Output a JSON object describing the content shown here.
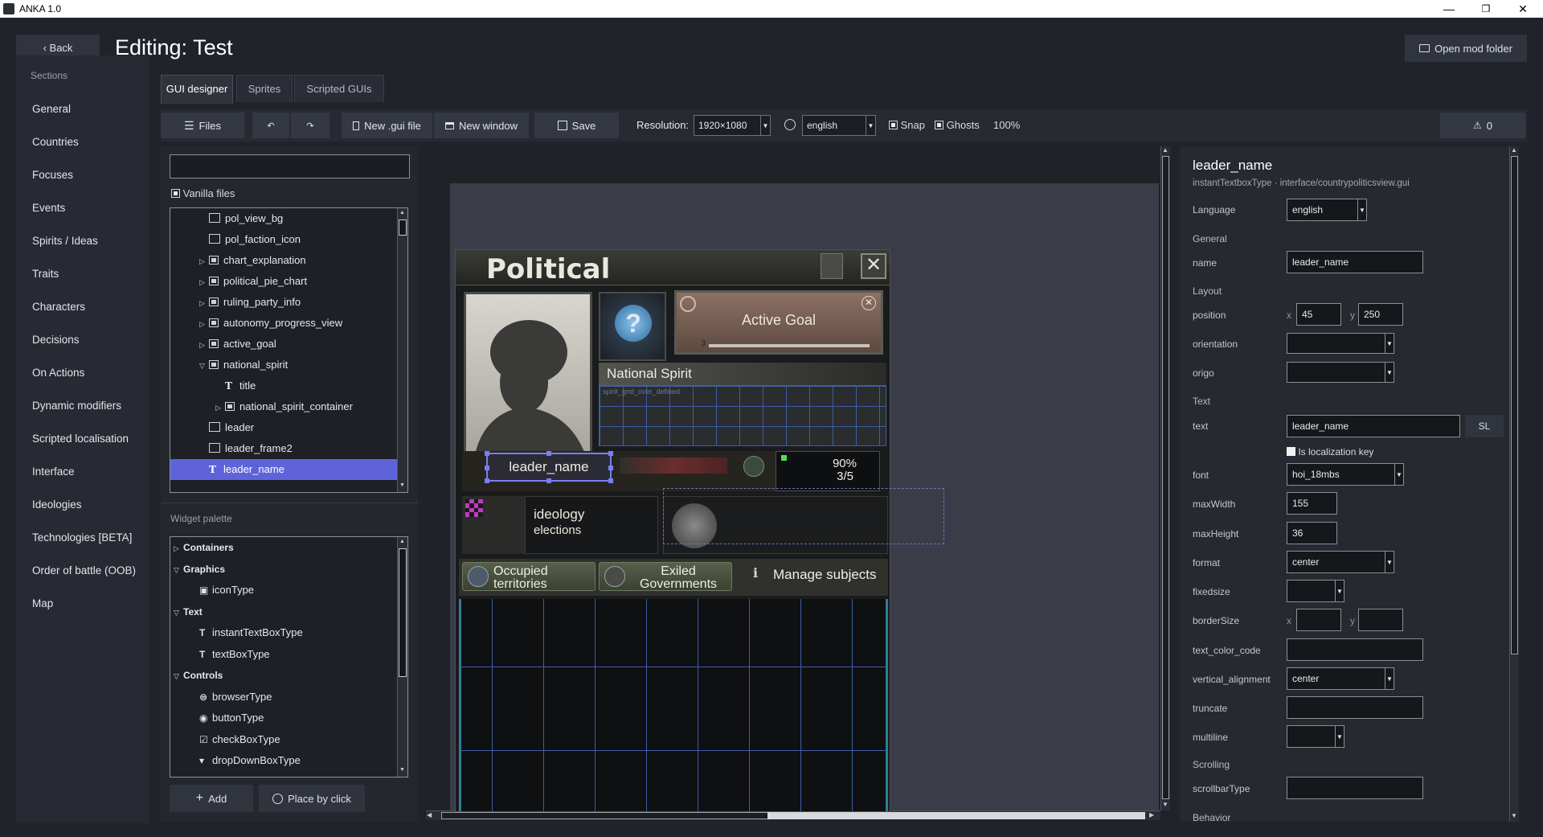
{
  "window": {
    "title": "ANKA 1.0",
    "minimize": "—",
    "maximize": "❐",
    "close": "✕"
  },
  "header": {
    "back_label": "‹ Back",
    "title": "Editing: Test",
    "open_mod_folder": "Open mod folder"
  },
  "sidebar": {
    "heading": "Sections",
    "items": [
      "General",
      "Countries",
      "Focuses",
      "Events",
      "Spirits / Ideas",
      "Traits",
      "Characters",
      "Decisions",
      "On Actions",
      "Dynamic modifiers",
      "Scripted localisation",
      "Interface",
      "Ideologies",
      "Technologies [BETA]",
      "Order of battle (OOB)",
      "Map"
    ]
  },
  "tabs": [
    "GUI designer",
    "Sprites",
    "Scripted GUIs"
  ],
  "toolbar": {
    "files": "Files",
    "new_gui_file": "New .gui file",
    "new_window": "New window",
    "save": "Save",
    "resolution_label": "Resolution:",
    "resolution_value": "1920×1080",
    "language_value": "english",
    "snap": "Snap",
    "ghosts": "Ghosts",
    "zoom": "100%",
    "warnings": "0"
  },
  "files_panel": {
    "search_value": "",
    "vanilla_files": "Vanilla files",
    "tree": [
      {
        "label": "pol_view_bg",
        "indent": 2,
        "kind": "icon",
        "expander": ""
      },
      {
        "label": "pol_faction_icon",
        "indent": 2,
        "kind": "icon",
        "expander": ""
      },
      {
        "label": "chart_explanation",
        "indent": 2,
        "kind": "container",
        "expander": "▷"
      },
      {
        "label": "political_pie_chart",
        "indent": 2,
        "kind": "container",
        "expander": "▷"
      },
      {
        "label": "ruling_party_info",
        "indent": 2,
        "kind": "container",
        "expander": "▷"
      },
      {
        "label": "autonomy_progress_view",
        "indent": 2,
        "kind": "container",
        "expander": "▷"
      },
      {
        "label": "active_goal",
        "indent": 2,
        "kind": "container",
        "expander": "▷"
      },
      {
        "label": "national_spirit",
        "indent": 2,
        "kind": "container",
        "expander": "▽"
      },
      {
        "label": "title",
        "indent": 3,
        "kind": "text",
        "expander": ""
      },
      {
        "label": "national_spirit_container",
        "indent": 3,
        "kind": "container",
        "expander": "▷"
      },
      {
        "label": "leader",
        "indent": 2,
        "kind": "icon",
        "expander": ""
      },
      {
        "label": "leader_frame2",
        "indent": 2,
        "kind": "icon",
        "expander": ""
      },
      {
        "label": "leader_name",
        "indent": 2,
        "kind": "text",
        "expander": ""
      }
    ],
    "palette_title": "Widget palette",
    "palette": [
      {
        "label": "Containers",
        "group": true,
        "expander": "▷"
      },
      {
        "label": "Graphics",
        "group": true,
        "expander": "▽"
      },
      {
        "label": "iconType",
        "group": false,
        "glyph": "▣"
      },
      {
        "label": "Text",
        "group": true,
        "expander": "▽"
      },
      {
        "label": "instantTextBoxType",
        "group": false,
        "glyph": "T"
      },
      {
        "label": "textBoxType",
        "group": false,
        "glyph": "T"
      },
      {
        "label": "Controls",
        "group": true,
        "expander": "▽"
      },
      {
        "label": "browserType",
        "group": false,
        "glyph": "⊜"
      },
      {
        "label": "buttonType",
        "group": false,
        "glyph": "◉"
      },
      {
        "label": "checkBoxType",
        "group": false,
        "glyph": "☑"
      },
      {
        "label": "dropDownBoxType",
        "group": false,
        "glyph": "▾"
      }
    ],
    "add_label": "Add",
    "place_by_click_label": "Place by click"
  },
  "gui_preview": {
    "window_title": "Political",
    "active_goal": "Active Goal",
    "goal_number": "3",
    "national_spirit": "National Spirit",
    "spirit_overlay": "spirit_grid_over_defined",
    "leader_name": "leader_name",
    "support_percent": "90%",
    "support_fraction": "3/5",
    "ideology": "ideology",
    "elections": "elections",
    "occupied_territories": "Occupied territories",
    "exiled_governments": "Exiled Governments",
    "manage_subjects": "Manage subjects"
  },
  "properties": {
    "element_name": "leader_name",
    "element_type": "instantTextboxType · interface/countrypoliticsview.gui",
    "language_label": "Language",
    "language_value": "english",
    "general_label": "General",
    "name_label": "name",
    "name_value": "leader_name",
    "layout_label": "Layout",
    "position_label": "position",
    "x_label": "x",
    "y_label": "y",
    "position_x": "45",
    "position_y": "250",
    "orientation_label": "orientation",
    "orientation_value": "",
    "origo_label": "origo",
    "origo_value": "",
    "text_section": "Text",
    "text_label": "text",
    "text_value": "leader_name",
    "sl_button": "SL",
    "is_loc_key": "Is localization key",
    "font_label": "font",
    "font_value": "hoi_18mbs",
    "maxwidth_label": "maxWidth",
    "maxwidth_value": "155",
    "maxheight_label": "maxHeight",
    "maxheight_value": "36",
    "format_label": "format",
    "format_value": "center",
    "fixedsize_label": "fixedsize",
    "fixedsize_value": "",
    "bordersize_label": "borderSize",
    "bordersize_x": "",
    "bordersize_y": "",
    "text_color_label": "text_color_code",
    "text_color_value": "",
    "valign_label": "vertical_alignment",
    "valign_value": "center",
    "truncate_label": "truncate",
    "truncate_value": "",
    "multiline_label": "multiline",
    "multiline_value": "",
    "scrolling_label": "Scrolling",
    "scrollbar_label": "scrollbarType",
    "scrollbar_value": "",
    "behavior_label": "Behavior"
  },
  "colors": {
    "accent": "#5f63d9",
    "background": "#20232a",
    "panel": "#272a32",
    "gui_grid": "#3d5fa8",
    "selection": "#7a7ff0"
  }
}
